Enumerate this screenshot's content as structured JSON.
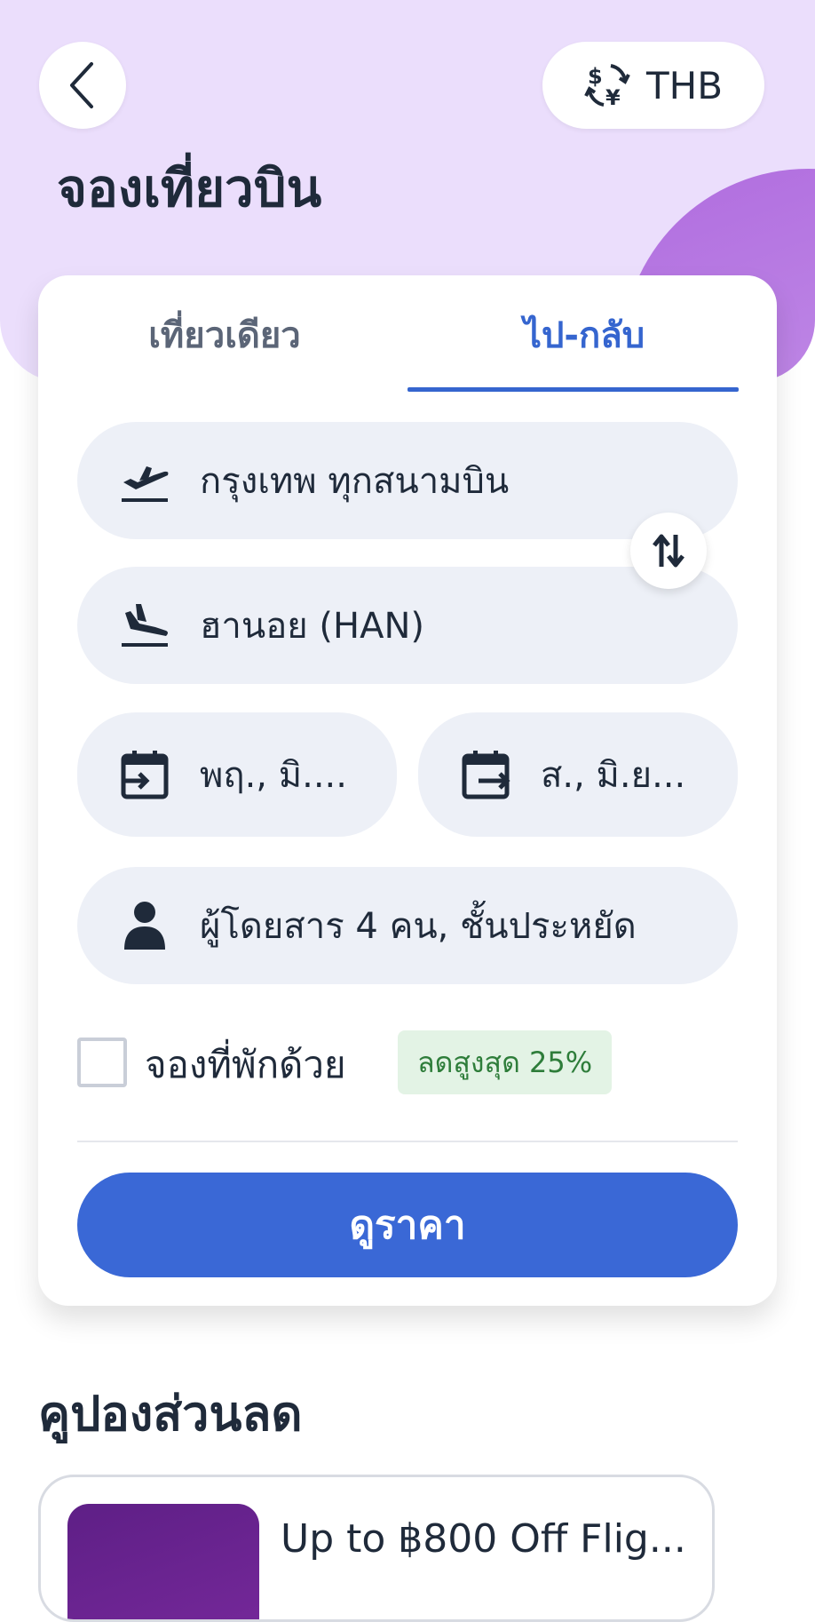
{
  "header": {
    "title": "จองเที่ยวบิน",
    "currency": "THB"
  },
  "tabs": [
    {
      "label": "เที่ยวเดียว",
      "selected": false
    },
    {
      "label": "ไป-กลับ",
      "selected": true
    }
  ],
  "form": {
    "origin": "กรุงเทพ ทุกสนามบิน",
    "destination": "ฮานอย (HAN)",
    "depart_date": "พฤ., มิ....",
    "return_date": "ส., มิ.ย...",
    "passengers": "ผู้โดยสาร 4 คน, ชั้นประหยัด",
    "hotel_checkbox_label": "จองที่พักด้วย",
    "hotel_checked": false,
    "discount_badge": "ลดสูงสุด 25%",
    "search_button": "ดูราคา"
  },
  "coupons": {
    "section_title": "คูปองส่วนลด",
    "items": [
      {
        "title": "Up to ฿800 Off Flig..."
      }
    ]
  },
  "colors": {
    "accent": "#3a68d6",
    "hero_bg": "#ebdefc",
    "field_bg": "#edf0f7",
    "badge_bg": "#e3f3e5",
    "badge_text": "#2e7d3a"
  },
  "icons": [
    "back-arrow-icon",
    "currency-exchange-icon",
    "plane-takeoff-icon",
    "plane-landing-icon",
    "swap-icon",
    "calendar-depart-icon",
    "calendar-return-icon",
    "person-icon"
  ]
}
